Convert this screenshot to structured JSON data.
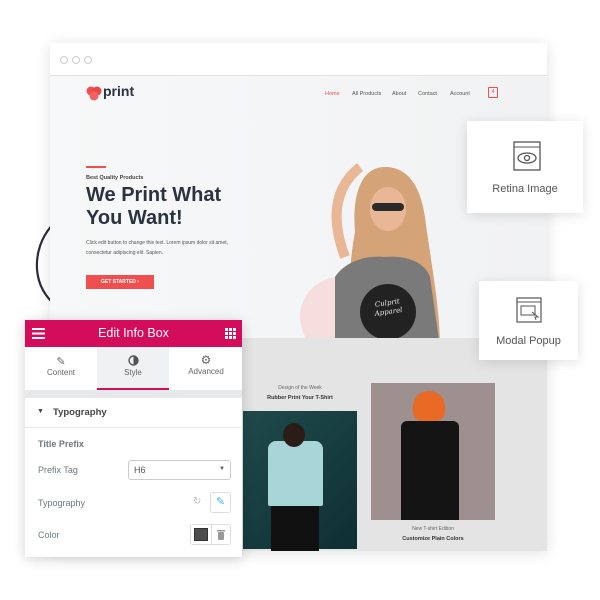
{
  "site": {
    "logo": "print",
    "nav": [
      "Home",
      "All Products",
      "About",
      "Contact",
      "Account"
    ],
    "cart_count": "4",
    "hero": {
      "eyebrow": "Best Quality Products",
      "title_line1": "We Print What",
      "title_line2": "You Want!",
      "body_line1": "Click edit button to change this text. Lorem ipsum dolor sit amet,",
      "body_line2": "consectetur adipiscing elit. Sapien.",
      "cta": "GET STARTED"
    },
    "shirt_text": "Culprit Apparel",
    "feature1": {
      "subtitle": "Design of the Week",
      "title": "Rubber Print Your T-Shirt"
    },
    "feature2": {
      "subtitle": "New T-shirt Edition",
      "title": "Customize Plain Colors"
    }
  },
  "cards": {
    "retina": "Retina Image",
    "modal": "Modal Popup"
  },
  "panel": {
    "title": "Edit Info Box",
    "tabs": [
      {
        "label": "Content",
        "icon": "pencil-icon"
      },
      {
        "label": "Style",
        "icon": "half-circle-icon"
      },
      {
        "label": "Advanced",
        "icon": "gear-icon"
      }
    ],
    "active_tab": "Style",
    "section": "Typography",
    "group": "Title Prefix",
    "prefix_tag_label": "Prefix Tag",
    "prefix_tag_value": "H6",
    "typography_label": "Typography",
    "color_label": "Color"
  },
  "colors": {
    "accent": "#d30c5c",
    "brand": "#f04f4f",
    "swatch": "#4d4d4d"
  }
}
